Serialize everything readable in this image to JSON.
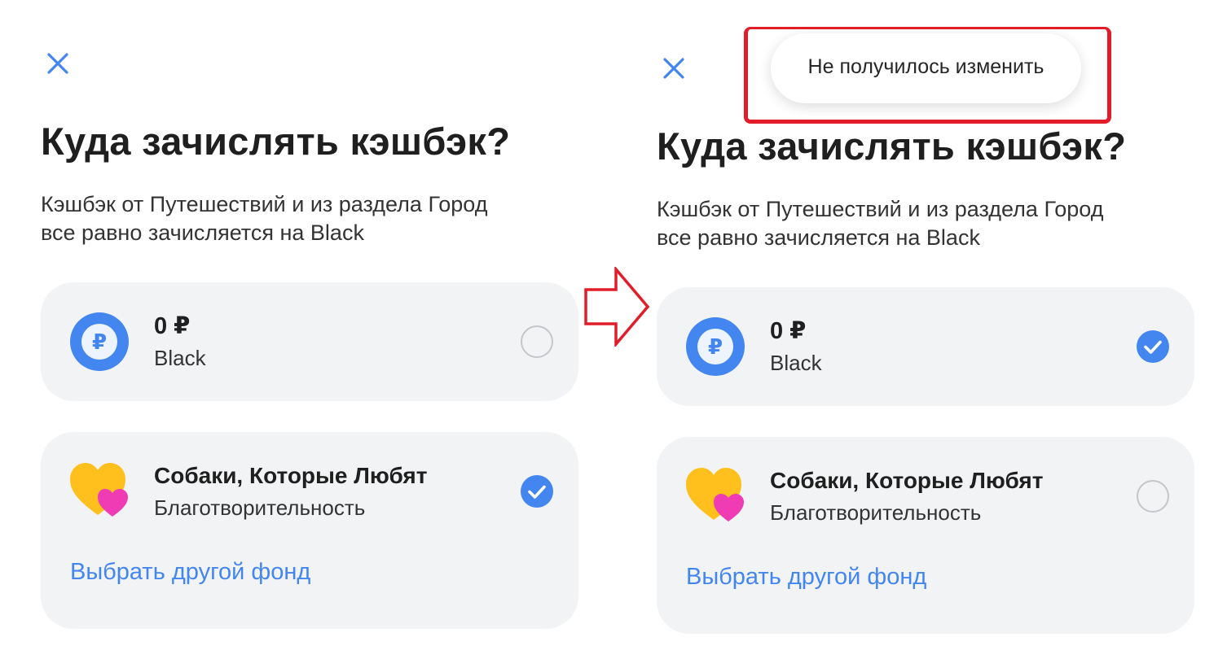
{
  "colors": {
    "accent": "#4386f0",
    "card_background": "#f2f3f5",
    "annotation_red": "#e11d2a",
    "heart_yellow": "#ffc01e",
    "heart_pink": "#f03cb4"
  },
  "icons": {
    "close": "close-icon",
    "coin": "ruble-coin-icon",
    "charity": "heart-icon",
    "checked": "check-icon",
    "arrow": "right-arrow-icon"
  },
  "screens": [
    {
      "title": "Куда зачислять кэшбэк?",
      "subtitle_line1": "Кэшбэк от Путешествий и из раздела Город",
      "subtitle_line2": "все равно зачисляется на Black",
      "black_option": {
        "amount": "0 ₽",
        "name": "Black",
        "coin_symbol": "₽",
        "selected": false
      },
      "charity_option": {
        "name": "Собаки, Которые Любят",
        "type": "Благотворительность",
        "link": "Выбрать другой фонд",
        "selected": true
      }
    },
    {
      "toast": "Не получилось изменить",
      "title": "Куда зачислять кэшбэк?",
      "subtitle_line1": "Кэшбэк от Путешествий и из раздела Город",
      "subtitle_line2": "все равно зачисляется на Black",
      "black_option": {
        "amount": "0 ₽",
        "name": "Black",
        "coin_symbol": "₽",
        "selected": true
      },
      "charity_option": {
        "name": "Собаки, Которые Любят",
        "type": "Благотворительность",
        "link": "Выбрать другой фонд",
        "selected": false
      }
    }
  ]
}
